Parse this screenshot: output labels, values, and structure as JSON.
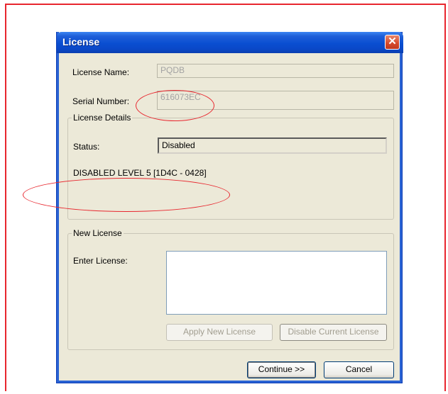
{
  "dialog": {
    "title": "License",
    "close_glyph": "✕",
    "license_name_label": "License Name:",
    "license_name_value": "PQDB",
    "serial_number_label": "Serial Number:",
    "serial_number_value": "616073EC",
    "details_group": {
      "legend": "License Details",
      "status_label": "Status:",
      "status_value": "Disabled",
      "info_text": "DISABLED LEVEL 5 [1D4C - 0428]"
    },
    "new_license_group": {
      "legend": "New License",
      "enter_label": "Enter License:",
      "enter_value": "",
      "apply_button": "Apply New License",
      "disable_button": "Disable Current License"
    },
    "continue_button": "Continue >>",
    "cancel_button": "Cancel"
  },
  "colors": {
    "annotation": "#e8262e",
    "titlebar": "#0a4ed1",
    "dialog_bg": "#ece9d8"
  }
}
